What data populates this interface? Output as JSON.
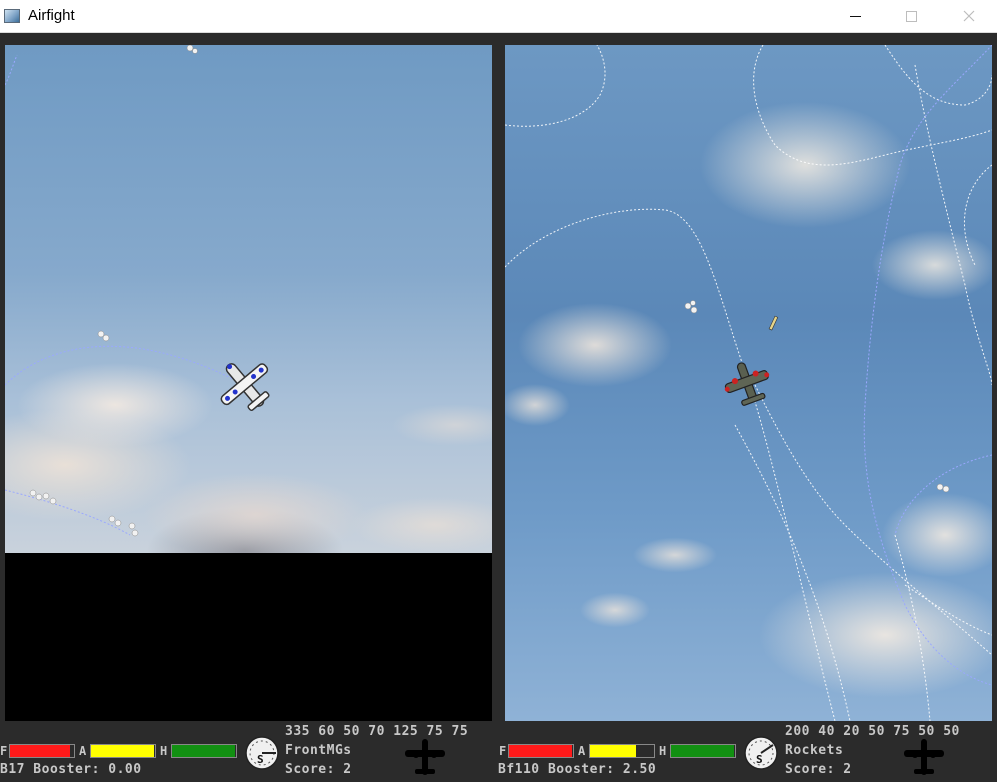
{
  "window": {
    "title": "Airfight"
  },
  "colors": {
    "fuel": "#ff1a1a",
    "ammo": "#ffff00",
    "health": "#129012",
    "hud_text": "#c8c8c8",
    "trail_blue": "#9aa8ff",
    "trail_white": "#ffffff"
  },
  "player1": {
    "bars": {
      "fuel_label": "F",
      "ammo_label": "A",
      "health_label": "H",
      "fuel": 0.93,
      "ammo": 0.98,
      "health": 0.98
    },
    "ammo_counts": "335 60 50 70 125 75 75",
    "weapon": "FrontMGs",
    "plane_booster": "B17 Booster: 0.00",
    "score": "Score: 2",
    "gauge_label": "S",
    "icon": "plane-silhouette-icon"
  },
  "player2": {
    "bars": {
      "fuel_label": "F",
      "ammo_label": "A",
      "health_label": "H",
      "fuel": 0.98,
      "ammo": 0.72,
      "health": 0.98
    },
    "ammo_counts": "200 40 20 50 75 50 50",
    "weapon": "Rockets",
    "plane_booster": "Bf110 Booster: 2.50",
    "score": "Score: 2",
    "gauge_label": "S",
    "icon": "plane-silhouette-icon"
  }
}
